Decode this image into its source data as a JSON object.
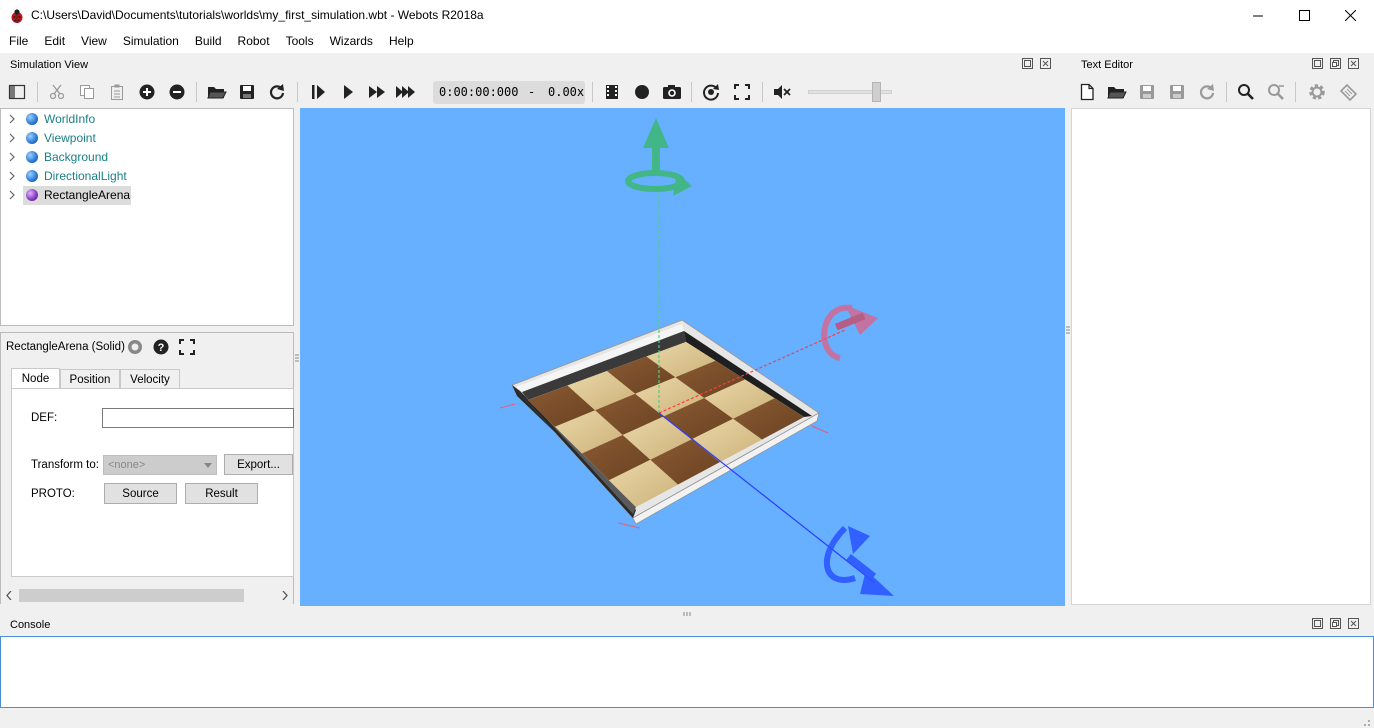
{
  "window": {
    "title": "C:\\Users\\David\\Documents\\tutorials\\worlds\\my_first_simulation.wbt - Webots R2018a",
    "app_icon": "ladybug-icon",
    "controls": [
      "minimize-icon",
      "maximize-icon",
      "close-icon"
    ]
  },
  "menu": [
    "File",
    "Edit",
    "View",
    "Simulation",
    "Build",
    "Robot",
    "Tools",
    "Wizards",
    "Help"
  ],
  "simulation_view": {
    "title": "Simulation View",
    "time": "0:00:00:000",
    "separator": "-",
    "speed": "0.00x",
    "toolbar_icons": [
      "toggle-scene-tree-icon",
      "cut-icon",
      "copy-icon",
      "paste-icon",
      "add-node-icon",
      "remove-node-icon",
      "open-world-icon",
      "save-world-icon",
      "reload-world-icon",
      "step-icon",
      "run-realtime-icon",
      "run-fast-icon",
      "run-fastest-icon",
      "record-movie-icon",
      "record-icon",
      "screenshot-icon",
      "follow-object-icon",
      "fullscreen-icon",
      "mute-icon"
    ],
    "volume": 0.8
  },
  "scene_tree": [
    {
      "label": "WorldInfo",
      "color": "#2f7fd8"
    },
    {
      "label": "Viewpoint",
      "color": "#2f7fd8"
    },
    {
      "label": "Background",
      "color": "#2f7fd8"
    },
    {
      "label": "DirectionalLight",
      "color": "#2f7fd8"
    },
    {
      "label": "RectangleArena",
      "color": "#8a3fc2",
      "selected": true
    }
  ],
  "field_editor": {
    "title": "RectangleArena (Solid)",
    "tabs": [
      "Node",
      "Position",
      "Velocity"
    ],
    "active_tab": "Node",
    "def_label": "DEF:",
    "def_value": "",
    "transform_label": "Transform to:",
    "transform_value": "<none>",
    "export_button": "Export...",
    "proto_label": "PROTO:",
    "source_button": "Source",
    "result_button": "Result"
  },
  "text_editor": {
    "title": "Text Editor",
    "toolbar_icons": [
      "new-file-icon",
      "open-file-icon",
      "save-file-icon",
      "save-as-icon",
      "revert-icon",
      "find-icon",
      "find-next-icon",
      "build-icon",
      "clean-icon"
    ]
  },
  "console": {
    "title": "Console"
  },
  "colors": {
    "view_background": "#66b0ff",
    "tree_text": "#1a7f86",
    "console_border": "#4a90d9"
  }
}
